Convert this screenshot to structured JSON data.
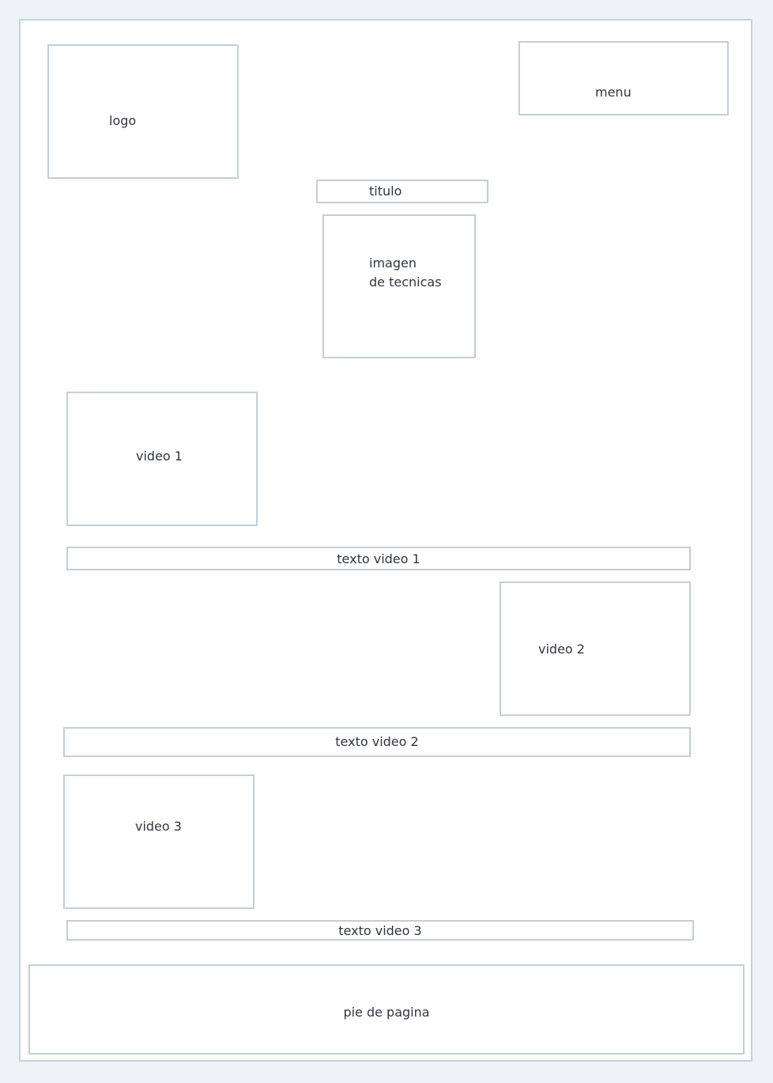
{
  "wireframe": {
    "logo": {
      "label": "logo"
    },
    "menu": {
      "label": "menu"
    },
    "title": {
      "label": "titulo"
    },
    "technique_image": {
      "label_line1": "imagen",
      "label_line2": "de tecnicas"
    },
    "video1": {
      "label": "video 1",
      "text_label": "texto video 1"
    },
    "video2": {
      "label": "video 2",
      "text_label": "texto video 2"
    },
    "video3": {
      "label": "video 3",
      "text_label": "texto video 3"
    },
    "footer": {
      "label": "pie de pagina"
    }
  },
  "colors": {
    "background": "#eef3f6",
    "page": "#ffffff",
    "border": "#c3ced8",
    "text": "#2f3540"
  }
}
